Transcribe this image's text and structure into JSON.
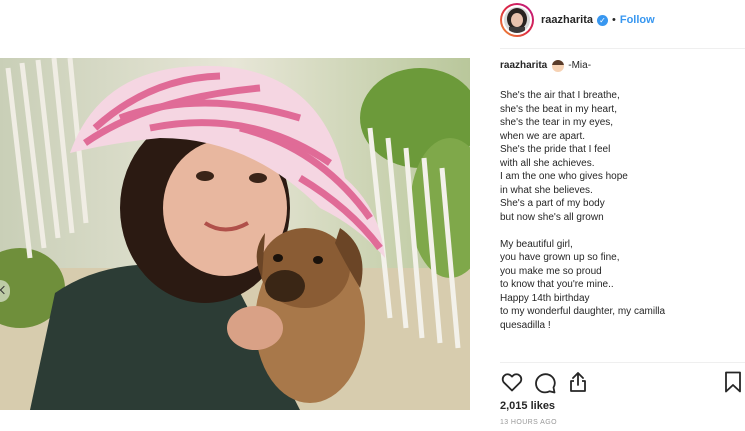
{
  "header": {
    "username": "raazharita",
    "separator": "•",
    "follow_label": "Follow"
  },
  "caption": {
    "username": "raazharita",
    "title": "-Mia-",
    "lines": [
      "She's the air that I breathe,",
      "she's the beat in my heart,",
      "she's the tear in my eyes,",
      "when we are apart.",
      "She's the pride that I feel",
      "with all she achieves.",
      "I am the one who gives hope",
      "in what she believes.",
      "She's a part of my body",
      "but now she's all grown",
      "",
      "My beautiful girl,",
      "you have grown up so fine,",
      "you make me so proud",
      "to know that you're mine..",
      "Happy 14th birthday",
      "to my wonderful daughter, my camilla",
      "quesadilla !"
    ]
  },
  "stats": {
    "likes": "2,015 likes",
    "posted": "13 HOURS AGO"
  },
  "icons": {
    "like": "heart-icon",
    "comment": "comment-icon",
    "share": "share-icon",
    "save": "bookmark-icon",
    "verified": "verified-badge-icon"
  },
  "colors": {
    "accent": "#3897f0",
    "text": "#262626",
    "muted": "#999999",
    "divider": "#efefef"
  }
}
